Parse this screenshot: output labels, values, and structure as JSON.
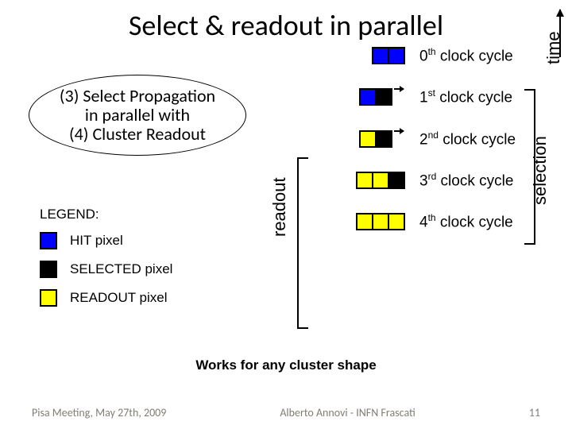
{
  "title": "Select & readout in parallel",
  "bubble": {
    "line1": "(3) Select Propagation",
    "line2": "in parallel with",
    "line3": "(4) Cluster Readout"
  },
  "legend": {
    "title": "LEGEND:",
    "hit": "HIT pixel",
    "selected": "SELECTED pixel",
    "readout": "READOUT pixel"
  },
  "cycles": {
    "c0_pre": "0",
    "c0_sup": "th",
    "c0_post": " clock cycle",
    "c1_pre": "1",
    "c1_sup": "st",
    "c1_post": " clock cycle",
    "c2_pre": "2",
    "c2_sup": "nd",
    "c2_post": " clock cycle",
    "c3_pre": "3",
    "c3_sup": "rd",
    "c3_post": " clock cycle",
    "c4_pre": "4",
    "c4_sup": "th",
    "c4_post": " clock cycle"
  },
  "labels": {
    "readout": "readout",
    "selection": "selection",
    "time": "time"
  },
  "works": "Works for any cluster shape",
  "footer": {
    "left": "Pisa Meeting, May 27th, 2009",
    "center": "Alberto Annovi - INFN Frascati",
    "right": "11"
  }
}
